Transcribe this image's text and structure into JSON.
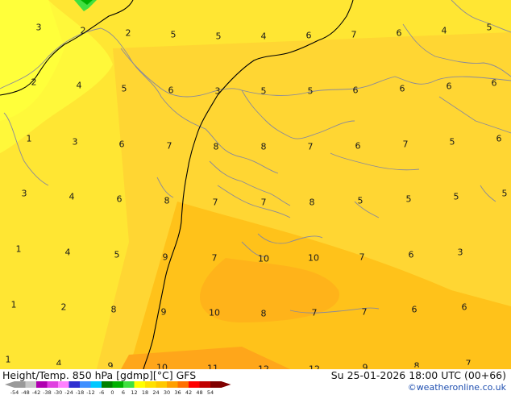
{
  "title": "Height/Temp. 850 hPa [gdmp][°C] GFS",
  "datetime": "Su 25-01-2026 18:00 UTC (00+66)",
  "credit": "©weatheronline.co.uk",
  "legend": {
    "ticks": [
      "-54",
      "-48",
      "-42",
      "-38",
      "-30",
      "-24",
      "-18",
      "-12",
      "-6",
      "0",
      "6",
      "12",
      "18",
      "24",
      "30",
      "36",
      "42",
      "48",
      "54"
    ],
    "colors": [
      "#9a9a9a",
      "#c8c8c8",
      "#b000b0",
      "#e040e0",
      "#ff80ff",
      "#3030d0",
      "#4090ff",
      "#00c8ff",
      "#008000",
      "#00b000",
      "#40e040",
      "#ffff00",
      "#ffe000",
      "#ffc800",
      "#ffa000",
      "#ff7000",
      "#ff0000",
      "#c00000",
      "#800000"
    ]
  },
  "values": [
    "3",
    "2",
    "2",
    "5",
    "5",
    "4",
    "6",
    "7",
    "6",
    "4",
    "5",
    "2",
    "4",
    "5",
    "6",
    "3",
    "5",
    "5",
    "6",
    "6",
    "6",
    "6",
    "1",
    "3",
    "6",
    "7",
    "8",
    "8",
    "7",
    "6",
    "7",
    "5",
    "6",
    "3",
    "4",
    "6",
    "8",
    "7",
    "7",
    "8",
    "5",
    "5",
    "5",
    "5",
    "1",
    "4",
    "5",
    "9",
    "7",
    "10",
    "10",
    "7",
    "6",
    "3",
    "1",
    "2",
    "8",
    "9",
    "10",
    "8",
    "7",
    "7",
    "6",
    "6",
    "1",
    "4",
    "9",
    "10",
    "11",
    "12",
    "12",
    "9",
    "8",
    "7"
  ]
}
